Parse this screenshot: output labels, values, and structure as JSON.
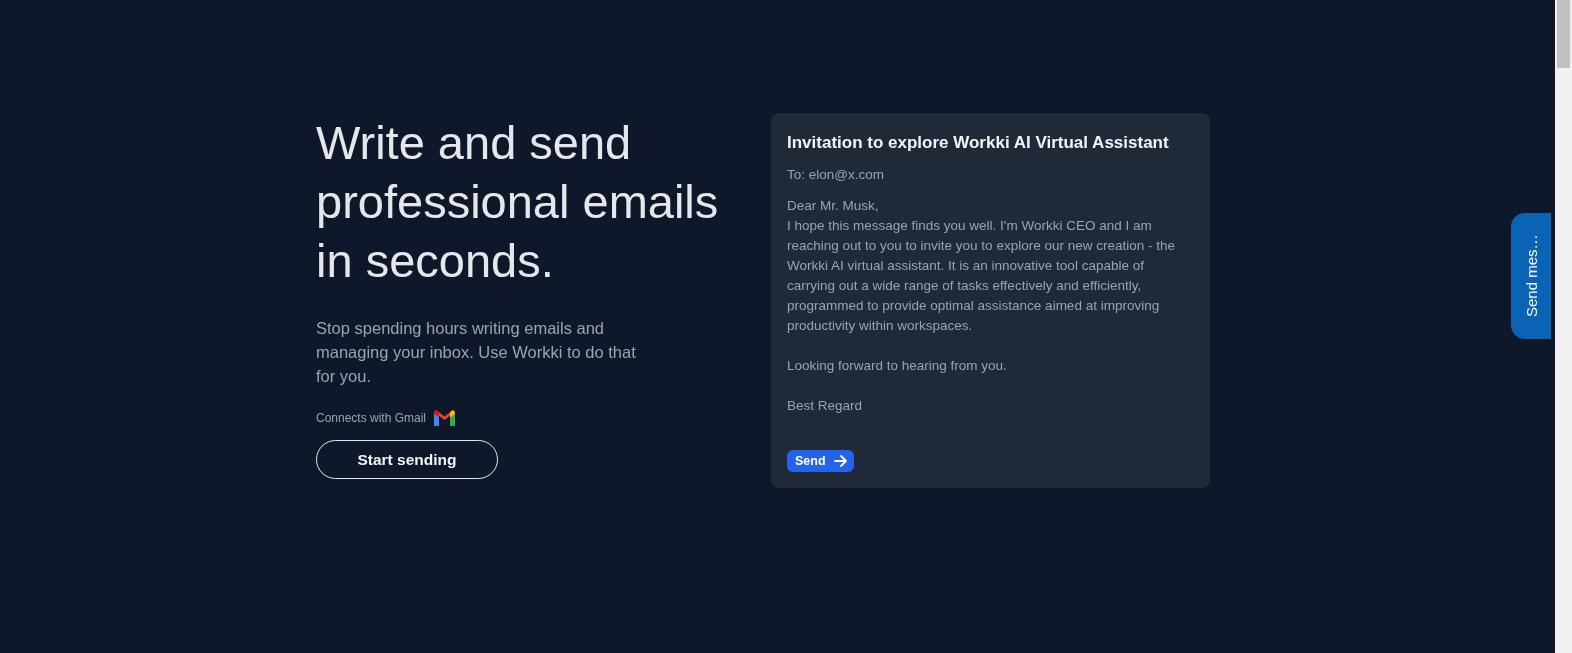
{
  "hero": {
    "heading": "Write and send professional emails in seconds.",
    "subheading": "Stop spending hours writing emails and managing your inbox. Use Workki to do that for you.",
    "connects_label": "Connects with Gmail",
    "cta": "Start sending"
  },
  "email": {
    "subject": "Invitation to explore Workki AI Virtual Assistant",
    "to": "To: elon@x.com",
    "paragraphs": [
      "Dear Mr. Musk,\nI hope this message finds you well. I'm Workki CEO and I am reaching out to you to invite you to explore our new creation - the Workki AI virtual assistant. It is an innovative tool capable of carrying out a wide range of tasks effectively and efficiently, programmed to provide optimal assistance aimed at improving productivity within workspaces.",
      "Looking forward to hearing from you.",
      "Best Regard"
    ],
    "send_button": "Send"
  },
  "side_tab": {
    "label": "Send mes…"
  }
}
